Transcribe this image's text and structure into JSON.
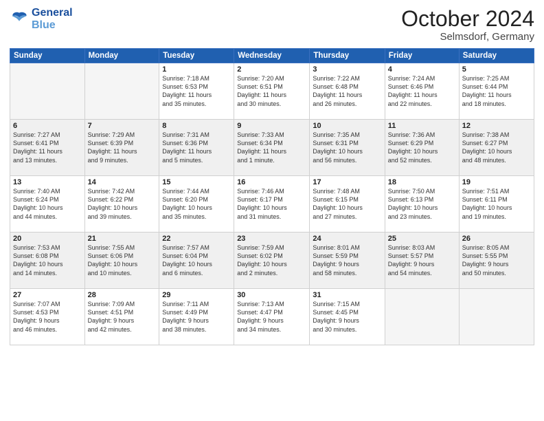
{
  "logo": {
    "line1": "General",
    "line2": "Blue"
  },
  "header": {
    "month": "October 2024",
    "location": "Selmsdorf, Germany"
  },
  "weekdays": [
    "Sunday",
    "Monday",
    "Tuesday",
    "Wednesday",
    "Thursday",
    "Friday",
    "Saturday"
  ],
  "weeks": [
    [
      {
        "num": "",
        "info": ""
      },
      {
        "num": "",
        "info": ""
      },
      {
        "num": "1",
        "info": "Sunrise: 7:18 AM\nSunset: 6:53 PM\nDaylight: 11 hours\nand 35 minutes."
      },
      {
        "num": "2",
        "info": "Sunrise: 7:20 AM\nSunset: 6:51 PM\nDaylight: 11 hours\nand 30 minutes."
      },
      {
        "num": "3",
        "info": "Sunrise: 7:22 AM\nSunset: 6:48 PM\nDaylight: 11 hours\nand 26 minutes."
      },
      {
        "num": "4",
        "info": "Sunrise: 7:24 AM\nSunset: 6:46 PM\nDaylight: 11 hours\nand 22 minutes."
      },
      {
        "num": "5",
        "info": "Sunrise: 7:25 AM\nSunset: 6:44 PM\nDaylight: 11 hours\nand 18 minutes."
      }
    ],
    [
      {
        "num": "6",
        "info": "Sunrise: 7:27 AM\nSunset: 6:41 PM\nDaylight: 11 hours\nand 13 minutes."
      },
      {
        "num": "7",
        "info": "Sunrise: 7:29 AM\nSunset: 6:39 PM\nDaylight: 11 hours\nand 9 minutes."
      },
      {
        "num": "8",
        "info": "Sunrise: 7:31 AM\nSunset: 6:36 PM\nDaylight: 11 hours\nand 5 minutes."
      },
      {
        "num": "9",
        "info": "Sunrise: 7:33 AM\nSunset: 6:34 PM\nDaylight: 11 hours\nand 1 minute."
      },
      {
        "num": "10",
        "info": "Sunrise: 7:35 AM\nSunset: 6:31 PM\nDaylight: 10 hours\nand 56 minutes."
      },
      {
        "num": "11",
        "info": "Sunrise: 7:36 AM\nSunset: 6:29 PM\nDaylight: 10 hours\nand 52 minutes."
      },
      {
        "num": "12",
        "info": "Sunrise: 7:38 AM\nSunset: 6:27 PM\nDaylight: 10 hours\nand 48 minutes."
      }
    ],
    [
      {
        "num": "13",
        "info": "Sunrise: 7:40 AM\nSunset: 6:24 PM\nDaylight: 10 hours\nand 44 minutes."
      },
      {
        "num": "14",
        "info": "Sunrise: 7:42 AM\nSunset: 6:22 PM\nDaylight: 10 hours\nand 39 minutes."
      },
      {
        "num": "15",
        "info": "Sunrise: 7:44 AM\nSunset: 6:20 PM\nDaylight: 10 hours\nand 35 minutes."
      },
      {
        "num": "16",
        "info": "Sunrise: 7:46 AM\nSunset: 6:17 PM\nDaylight: 10 hours\nand 31 minutes."
      },
      {
        "num": "17",
        "info": "Sunrise: 7:48 AM\nSunset: 6:15 PM\nDaylight: 10 hours\nand 27 minutes."
      },
      {
        "num": "18",
        "info": "Sunrise: 7:50 AM\nSunset: 6:13 PM\nDaylight: 10 hours\nand 23 minutes."
      },
      {
        "num": "19",
        "info": "Sunrise: 7:51 AM\nSunset: 6:11 PM\nDaylight: 10 hours\nand 19 minutes."
      }
    ],
    [
      {
        "num": "20",
        "info": "Sunrise: 7:53 AM\nSunset: 6:08 PM\nDaylight: 10 hours\nand 14 minutes."
      },
      {
        "num": "21",
        "info": "Sunrise: 7:55 AM\nSunset: 6:06 PM\nDaylight: 10 hours\nand 10 minutes."
      },
      {
        "num": "22",
        "info": "Sunrise: 7:57 AM\nSunset: 6:04 PM\nDaylight: 10 hours\nand 6 minutes."
      },
      {
        "num": "23",
        "info": "Sunrise: 7:59 AM\nSunset: 6:02 PM\nDaylight: 10 hours\nand 2 minutes."
      },
      {
        "num": "24",
        "info": "Sunrise: 8:01 AM\nSunset: 5:59 PM\nDaylight: 9 hours\nand 58 minutes."
      },
      {
        "num": "25",
        "info": "Sunrise: 8:03 AM\nSunset: 5:57 PM\nDaylight: 9 hours\nand 54 minutes."
      },
      {
        "num": "26",
        "info": "Sunrise: 8:05 AM\nSunset: 5:55 PM\nDaylight: 9 hours\nand 50 minutes."
      }
    ],
    [
      {
        "num": "27",
        "info": "Sunrise: 7:07 AM\nSunset: 4:53 PM\nDaylight: 9 hours\nand 46 minutes."
      },
      {
        "num": "28",
        "info": "Sunrise: 7:09 AM\nSunset: 4:51 PM\nDaylight: 9 hours\nand 42 minutes."
      },
      {
        "num": "29",
        "info": "Sunrise: 7:11 AM\nSunset: 4:49 PM\nDaylight: 9 hours\nand 38 minutes."
      },
      {
        "num": "30",
        "info": "Sunrise: 7:13 AM\nSunset: 4:47 PM\nDaylight: 9 hours\nand 34 minutes."
      },
      {
        "num": "31",
        "info": "Sunrise: 7:15 AM\nSunset: 4:45 PM\nDaylight: 9 hours\nand 30 minutes."
      },
      {
        "num": "",
        "info": ""
      },
      {
        "num": "",
        "info": ""
      }
    ]
  ]
}
